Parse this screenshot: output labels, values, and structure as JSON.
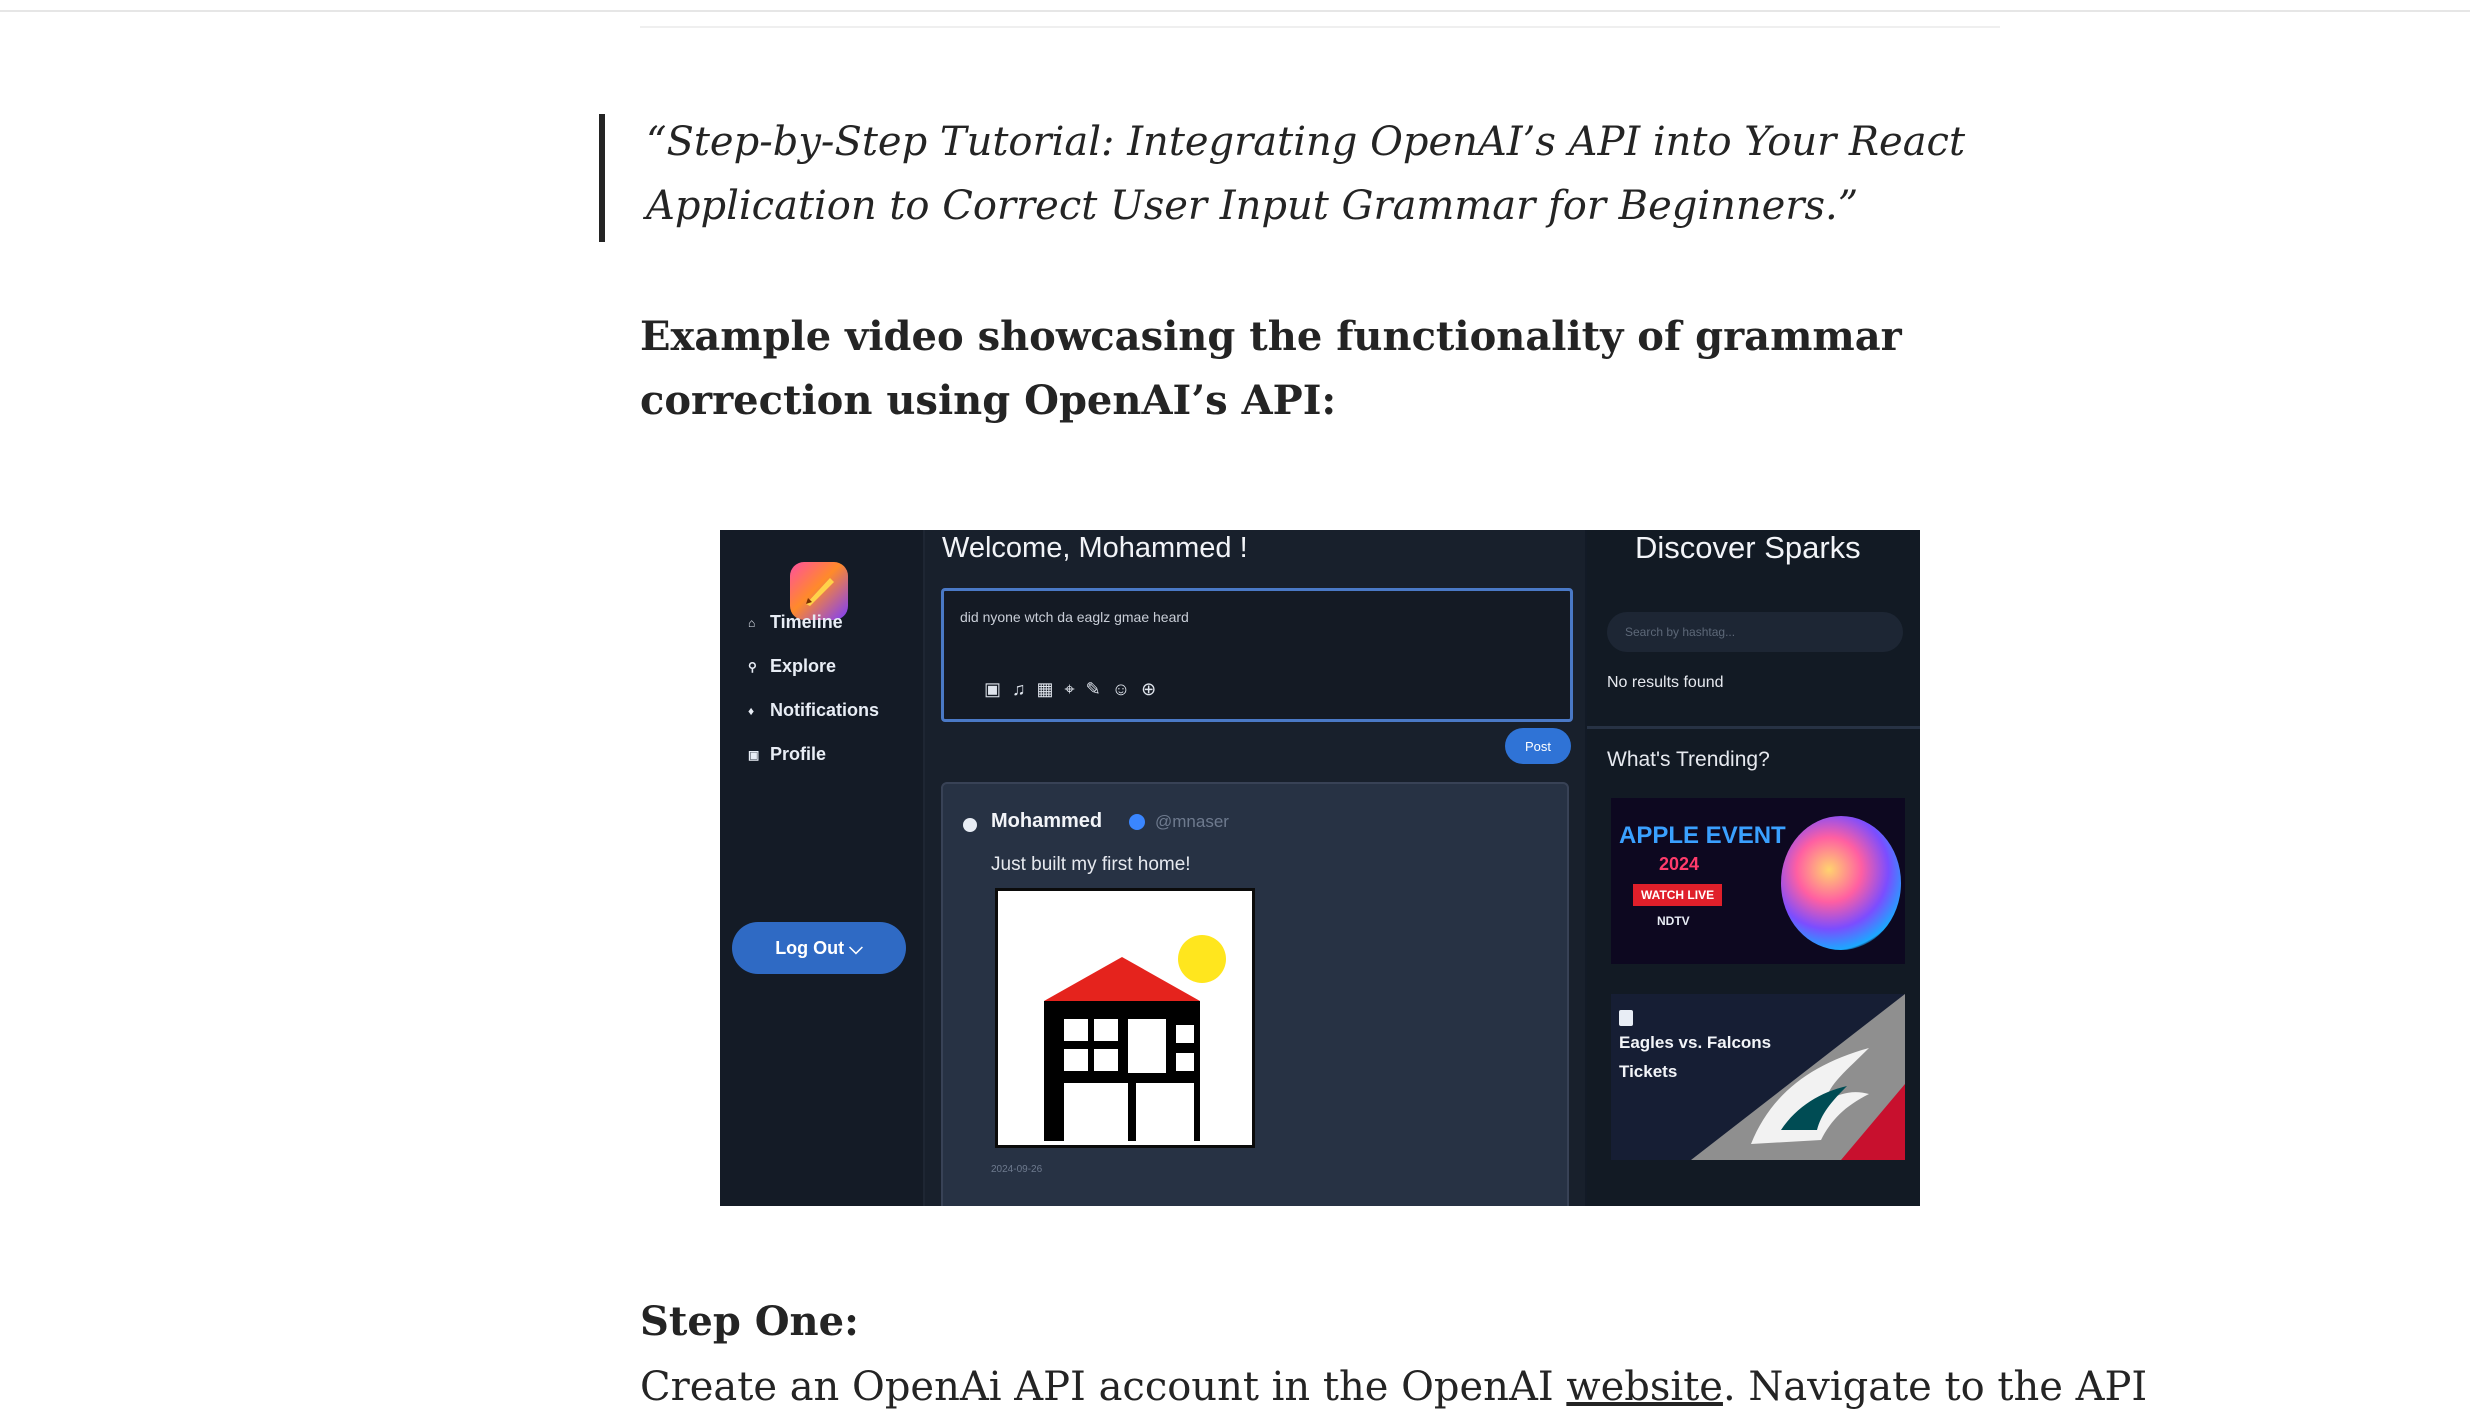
{
  "article": {
    "quote": "“Step-by-Step Tutorial: Integrating OpenAI’s API into Your React Application to Correct User Input Grammar for Beginners.”",
    "heading": "Example video showcasing the functionality of grammar correction using OpenAI’s API:",
    "step_title": "Step One:",
    "para_before_link": "Create an OpenAi API account in the OpenAI ",
    "link_text": "website",
    "para_after_link": ". Navigate to the API"
  },
  "video": {
    "sidebar": {
      "items": [
        {
          "label": "Timeline",
          "icon": "home-icon"
        },
        {
          "label": "Explore",
          "icon": "search-icon"
        },
        {
          "label": "Notifications",
          "icon": "bell-icon"
        },
        {
          "label": "Profile",
          "icon": "profile-icon"
        }
      ],
      "logout_label": "Log Out ⌵"
    },
    "main": {
      "welcome": "Welcome, Mohammed !",
      "composer_text": "did nyone wtch da eaglz gmae heard",
      "post_label": "Post",
      "post": {
        "name": "Mohammed",
        "handle": "@mnaser",
        "text": "Just built my first home!",
        "date": "2024-09-26"
      }
    },
    "right": {
      "title": "Discover Sparks",
      "search_placeholder": "Search by hashtag...",
      "no_results": "No results found",
      "trending_title": "What's Trending?",
      "trend1": {
        "title": "APPLE EVENT",
        "year": "2024",
        "badge": "WATCH LIVE",
        "source": "NDTV"
      },
      "trend2": {
        "line1": "Eagles vs. Falcons",
        "line2": "Tickets"
      }
    }
  }
}
